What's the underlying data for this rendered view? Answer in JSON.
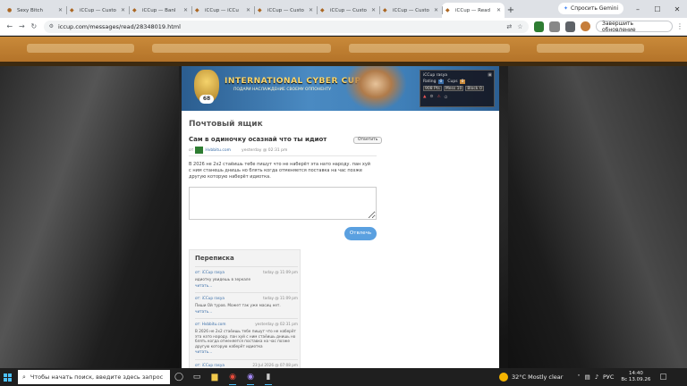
{
  "browser": {
    "tabs": [
      {
        "title": "Sexy Bitch",
        "active": false
      },
      {
        "title": "iCCup — Custo",
        "active": false
      },
      {
        "title": "iCCup — Banl",
        "active": false
      },
      {
        "title": "iCCup — iCCu",
        "active": false
      },
      {
        "title": "iCCup — Custo",
        "active": false
      },
      {
        "title": "iCCup — Custo",
        "active": false
      },
      {
        "title": "iCCup — Custo",
        "active": false
      },
      {
        "title": "iCCup — Read",
        "active": true
      }
    ],
    "new_tab": "+",
    "gemini_label": "Спросить Gemini",
    "url": "iccup.com/messages/read/28348019.html",
    "update_label": "Завершить обновление"
  },
  "site": {
    "banner_title": "INTERNATIONAL CYBER CUP",
    "banner_subtitle": "ПОДАРИ НАСЛАЖДЕНИЕ СВОЕМУ ОППОНЕНТУ",
    "level_badge": "68",
    "userbox": {
      "username": "iCCup rasya",
      "rating_label": "Rating",
      "rating_value": "0",
      "cups_label": "Cups",
      "cups_value": "0",
      "field1": "908 Pts",
      "field2": "Mess 10",
      "field3": "Block 0"
    }
  },
  "mailbox": {
    "title": "Почтовый ящик",
    "subject": "Сам в одиночку осазнай что ты идиот",
    "reply_top_label": "Ответить",
    "from_prefix": "от",
    "sender": "Hvbbitu.com",
    "time": "yesterday @ 02:31 pm",
    "body": "В 2026 не 2х2 стаёишь тебе пишут что не наберёт эта нато народу. пан хуй с ним станешь днишь но блять когда отменяется поставка на час позже другую которую наберёт идиотка.",
    "send_label": "Отвлечь"
  },
  "correspondence": {
    "title": "Переписка",
    "items": [
      {
        "from": "от: iCCup rasya",
        "time": "today @ 11:09 pm",
        "text": "идиотку увидешь в зеркале",
        "more": "читать..."
      },
      {
        "from": "от: iCCup rasya",
        "time": "today @ 11:09 pm",
        "text": "Пиши Ой туров. Может так уже масиц нет.",
        "more": "читать..."
      },
      {
        "from": "от: Hvbbitu.com",
        "time": "yesterday @ 02:31 pm",
        "text": "В 2026 не 2х2 стаёишь тебе пишут что не наберёт эта нато народу. пан хуй с ним стаёишь днишь но блять когда отменяется поставка на час позже другую которую наберёт идиотка",
        "more": "читать..."
      },
      {
        "from": "от: iCCup rasya",
        "time": "23 Jul 2026 @ 07:08 pm",
        "text": "",
        "more": ""
      }
    ]
  },
  "taskbar": {
    "search_placeholder": "Чтобы начать поиск, введите здесь запрос",
    "weather": "32°C  Mostly clear",
    "lang": "РУС",
    "time": "14:40",
    "date": "Вс 13.09.26"
  }
}
